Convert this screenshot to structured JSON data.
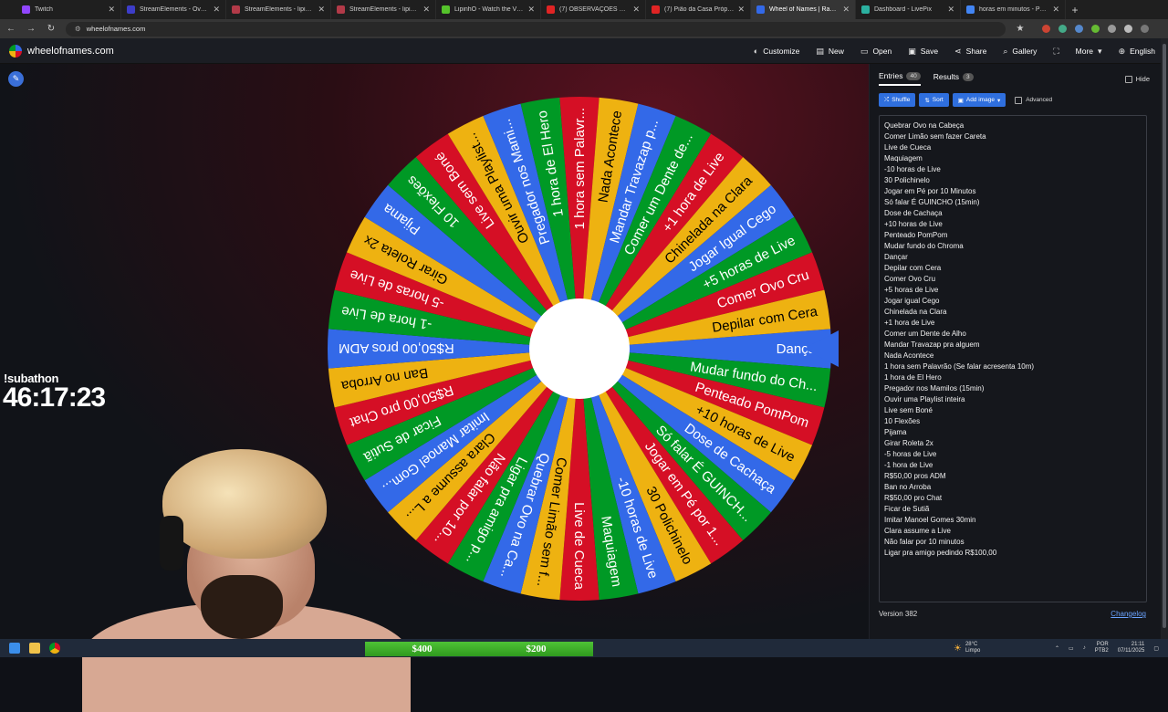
{
  "browser": {
    "tabs": [
      {
        "title": "Twitch",
        "color": "#9146ff",
        "active": false
      },
      {
        "title": "StreamElements - Overlays",
        "color": "#3d3dc9",
        "active": false
      },
      {
        "title": "StreamElements - lipinho",
        "color": "#b23a48",
        "active": false
      },
      {
        "title": "StreamElements - lipinho",
        "color": "#b23a48",
        "active": false
      },
      {
        "title": "LipinhO - Watch the VOD on",
        "color": "#55c32b",
        "active": false
      },
      {
        "title": "(7) OBSERVAÇÕES DIÁRIAS (t",
        "color": "#e02424",
        "active": false
      },
      {
        "title": "(7) Pião da Casa Própria / Pra",
        "color": "#e02424",
        "active": false
      },
      {
        "title": "Wheel of Names | Random na",
        "color": "#3369e8",
        "active": true
      },
      {
        "title": "Dashboard - LivePix",
        "color": "#2bb0a0",
        "active": false
      },
      {
        "title": "horas em minutos - Pesquisa",
        "color": "#4285f4",
        "active": false
      }
    ],
    "url": "wheelofnames.com"
  },
  "header": {
    "site_name": "wheelofnames.com",
    "menu": [
      {
        "label": "Customize",
        "icon": "palette-icon",
        "glyph": "◐"
      },
      {
        "label": "New",
        "icon": "new-file-icon",
        "glyph": "▤"
      },
      {
        "label": "Open",
        "icon": "folder-icon",
        "glyph": "▭"
      },
      {
        "label": "Save",
        "icon": "save-icon",
        "glyph": "▣"
      },
      {
        "label": "Share",
        "icon": "share-icon",
        "glyph": "⋖"
      },
      {
        "label": "Gallery",
        "icon": "search-icon",
        "glyph": "⌕"
      },
      {
        "label": "",
        "icon": "fullscreen-icon",
        "glyph": "⛶"
      },
      {
        "label": "More",
        "icon": "chevron-down-icon",
        "glyph": "▾"
      },
      {
        "label": "English",
        "icon": "globe-icon",
        "glyph": "⊕"
      }
    ]
  },
  "overlay": {
    "subathon_label": "!subathon",
    "subathon_timer": "46:17:23",
    "money_left": "$400",
    "money_right": "$200"
  },
  "wheel": {
    "colors": [
      "#3369e8",
      "#009925",
      "#d50f25",
      "#eeb211"
    ],
    "pointer_color": "#3369e8",
    "segments": [
      "Dançar",
      "Mudar fundo do Ch...",
      "Penteado PomPom",
      "+10 horas de Live",
      "Dose de Cachaça",
      "Só falar É GUINCH...",
      "Jogar em Pé por 1...",
      "30 Polichinelo",
      "-10 horas de Live",
      "Maquiagem",
      "Live de Cueca",
      "Comer Limão sem f...",
      "Quebrar Ovo na Ca...",
      "Ligar pra amigo p...",
      "Não falar por 10...",
      "Clara assume a L...",
      "Imitar Manoel Gom...",
      "Ficar de Sutiã",
      "R$50,00 pro Chat",
      "Ban no Arroba",
      "R$50,00 pros ADM",
      "-1 hora de Live",
      "-5 horas de Live",
      "Girar Roleta 2x",
      "Pijama",
      "10 Flexões",
      "Live sem Boné",
      "Ouvir uma Playlist...",
      "Pregador nos Mami...",
      "1 hora de El Hero",
      "1 hora sem Palavr...",
      "Nada Acontece",
      "Mandar Travazap p...",
      "Comer um Dente de...",
      "+1 hora de Live",
      "Chinelada na Clara",
      "Jogar Igual Cego",
      "+5 horas de Live",
      "Comer Ovo Cru",
      "Depilar com Cera"
    ]
  },
  "panel": {
    "tab_entries": "Entries",
    "entries_count": "40",
    "tab_results": "Results",
    "results_count": "3",
    "hide_label": "Hide",
    "shuffle_label": "Shuffle",
    "sort_label": "Sort",
    "add_image_label": "Add image",
    "advanced_label": "Advanced",
    "entries": [
      "Quebrar Ovo na Cabeça",
      "Comer Limão sem fazer Careta",
      "Live de Cueca",
      "Maquiagem",
      "-10 horas de Live",
      "30 Polichinelo",
      "Jogar em Pé por 10 Minutos",
      "Só falar É GUINCHO (15min)",
      "Dose de Cachaça",
      "+10 horas de Live",
      "Penteado PomPom",
      "Mudar fundo do Chroma",
      "Dançar",
      "Depilar com Cera",
      "Comer Ovo Cru",
      "+5 horas de Live",
      "Jogar igual Cego",
      "Chinelada na Clara",
      "+1 hora de Live",
      "Comer um Dente de Alho",
      "Mandar Travazap pra alguem",
      "Nada Acontece",
      "1 hora sem Palavrão (Se falar acresenta 10m)",
      "1 hora de El Hero",
      "Pregador nos Mamilos (15min)",
      "Ouvir uma Playlist inteira",
      "Live sem Boné",
      "10 Flexões",
      "Pijama",
      "Girar Roleta 2x",
      "-5 horas de Live",
      "-1 hora de Live",
      "R$50,00 pros ADM",
      "Ban no Arroba",
      "R$50,00 pro Chat",
      "Ficar de Sutiã",
      "Imitar Manoel Gomes 30min",
      "Clara assume a Live",
      "Não falar por 10 minutos",
      "Ligar pra amigo pedindo R$100,00"
    ],
    "version": "Version 382",
    "changelog": "Changelog"
  },
  "taskbar": {
    "weather_temp": "28°C",
    "weather_desc": "Limpo",
    "lang": "POR",
    "kbd": "PTB2",
    "time": "21:11",
    "date": "07/11/2025"
  }
}
